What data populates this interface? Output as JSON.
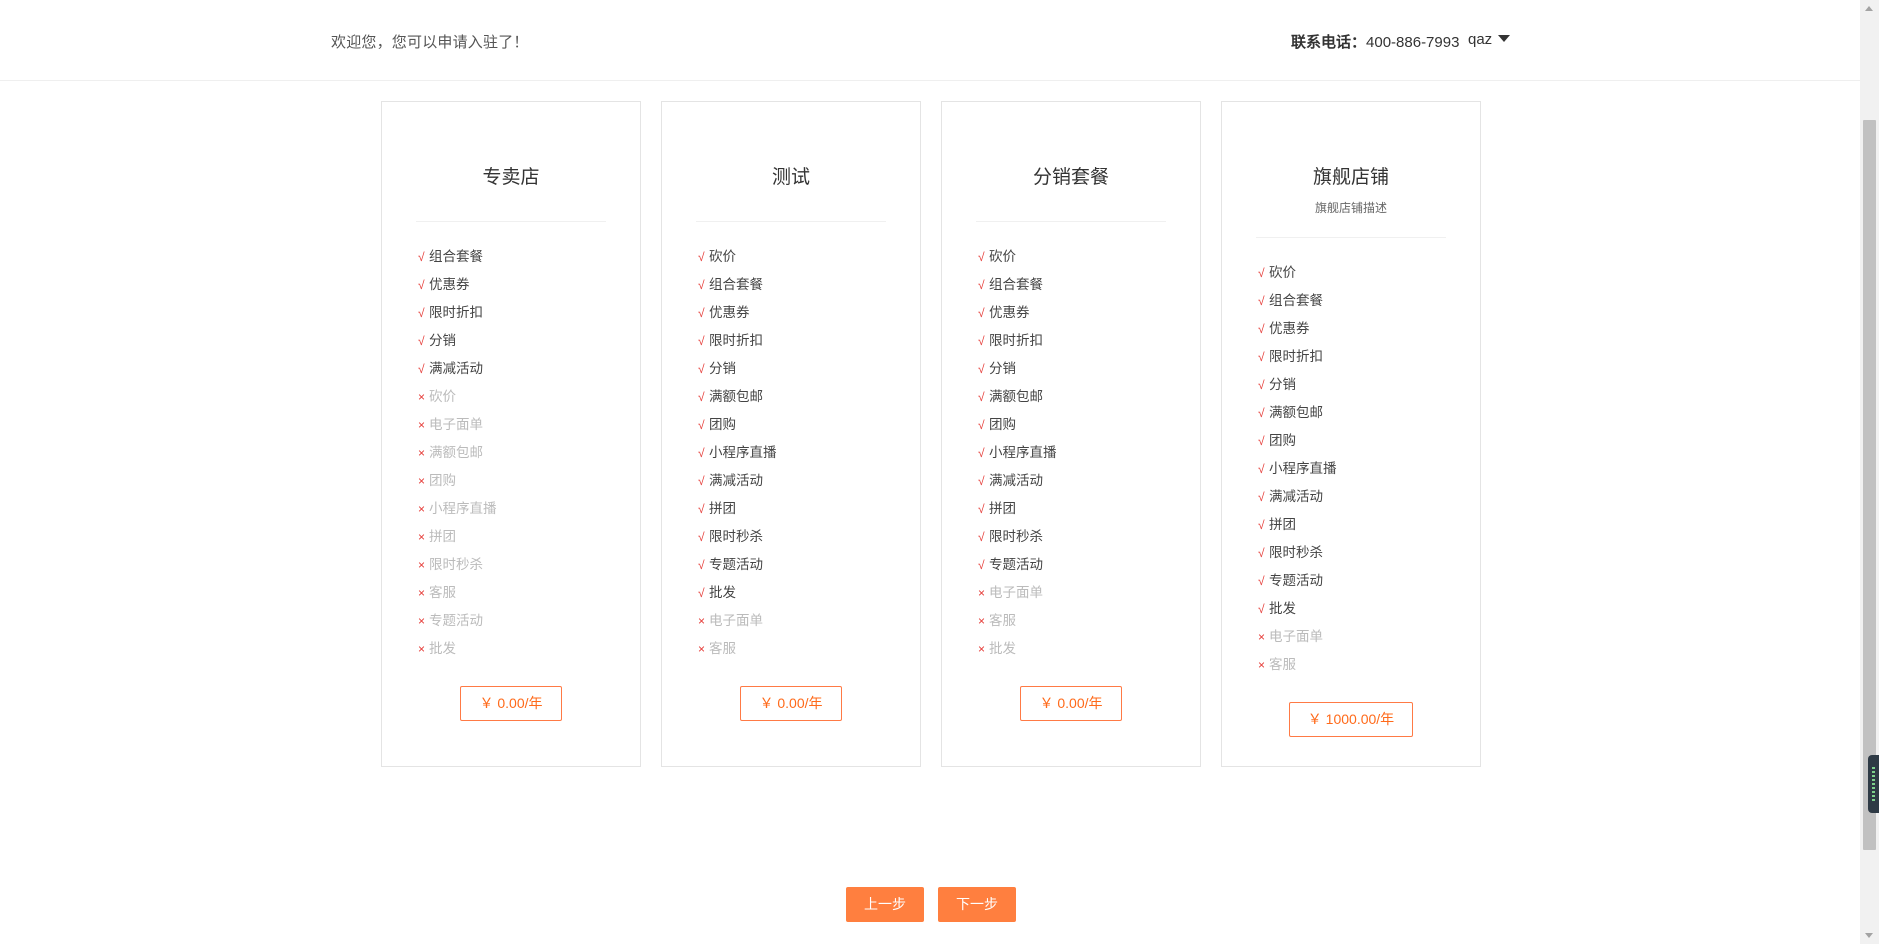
{
  "header": {
    "welcome_text": "欢迎您，您可以申请入驻了！",
    "contact_label": "联系电话：",
    "contact_phone": "400-886-7993",
    "username": "qaz"
  },
  "plans": [
    {
      "name": "专卖店",
      "description": "",
      "features": [
        {
          "name": "组合套餐",
          "included": true
        },
        {
          "name": "优惠券",
          "included": true
        },
        {
          "name": "限时折扣",
          "included": true
        },
        {
          "name": "分销",
          "included": true
        },
        {
          "name": "满减活动",
          "included": true
        },
        {
          "name": "砍价",
          "included": false
        },
        {
          "name": "电子面单",
          "included": false
        },
        {
          "name": "满额包邮",
          "included": false
        },
        {
          "name": "团购",
          "included": false
        },
        {
          "name": "小程序直播",
          "included": false
        },
        {
          "name": "拼团",
          "included": false
        },
        {
          "name": "限时秒杀",
          "included": false
        },
        {
          "name": "客服",
          "included": false
        },
        {
          "name": "专题活动",
          "included": false
        },
        {
          "name": "批发",
          "included": false
        }
      ],
      "price_label": "￥ 0.00/年"
    },
    {
      "name": "测试",
      "description": "",
      "features": [
        {
          "name": "砍价",
          "included": true
        },
        {
          "name": "组合套餐",
          "included": true
        },
        {
          "name": "优惠券",
          "included": true
        },
        {
          "name": "限时折扣",
          "included": true
        },
        {
          "name": "分销",
          "included": true
        },
        {
          "name": "满额包邮",
          "included": true
        },
        {
          "name": "团购",
          "included": true
        },
        {
          "name": "小程序直播",
          "included": true
        },
        {
          "name": "满减活动",
          "included": true
        },
        {
          "name": "拼团",
          "included": true
        },
        {
          "name": "限时秒杀",
          "included": true
        },
        {
          "name": "专题活动",
          "included": true
        },
        {
          "name": "批发",
          "included": true
        },
        {
          "name": "电子面单",
          "included": false
        },
        {
          "name": "客服",
          "included": false
        }
      ],
      "price_label": "￥ 0.00/年"
    },
    {
      "name": "分销套餐",
      "description": "",
      "features": [
        {
          "name": "砍价",
          "included": true
        },
        {
          "name": "组合套餐",
          "included": true
        },
        {
          "name": "优惠券",
          "included": true
        },
        {
          "name": "限时折扣",
          "included": true
        },
        {
          "name": "分销",
          "included": true
        },
        {
          "name": "满额包邮",
          "included": true
        },
        {
          "name": "团购",
          "included": true
        },
        {
          "name": "小程序直播",
          "included": true
        },
        {
          "name": "满减活动",
          "included": true
        },
        {
          "name": "拼团",
          "included": true
        },
        {
          "name": "限时秒杀",
          "included": true
        },
        {
          "name": "专题活动",
          "included": true
        },
        {
          "name": "电子面单",
          "included": false
        },
        {
          "name": "客服",
          "included": false
        },
        {
          "name": "批发",
          "included": false
        }
      ],
      "price_label": "￥ 0.00/年"
    },
    {
      "name": "旗舰店铺",
      "description": "旗舰店铺描述",
      "features": [
        {
          "name": "砍价",
          "included": true
        },
        {
          "name": "组合套餐",
          "included": true
        },
        {
          "name": "优惠券",
          "included": true
        },
        {
          "name": "限时折扣",
          "included": true
        },
        {
          "name": "分销",
          "included": true
        },
        {
          "name": "满额包邮",
          "included": true
        },
        {
          "name": "团购",
          "included": true
        },
        {
          "name": "小程序直播",
          "included": true
        },
        {
          "name": "满减活动",
          "included": true
        },
        {
          "name": "拼团",
          "included": true
        },
        {
          "name": "限时秒杀",
          "included": true
        },
        {
          "name": "专题活动",
          "included": true
        },
        {
          "name": "批发",
          "included": true
        },
        {
          "name": "电子面单",
          "included": false
        },
        {
          "name": "客服",
          "included": false
        }
      ],
      "price_label": "￥ 1000.00/年"
    }
  ],
  "marks": {
    "included": "√",
    "excluded": "×"
  },
  "footer": {
    "prev_label": "上一步",
    "next_label": "下一步"
  },
  "colors": {
    "accent": "#ff7f3f",
    "mark": "#e53935",
    "disabled_text": "#bbbbbb"
  }
}
